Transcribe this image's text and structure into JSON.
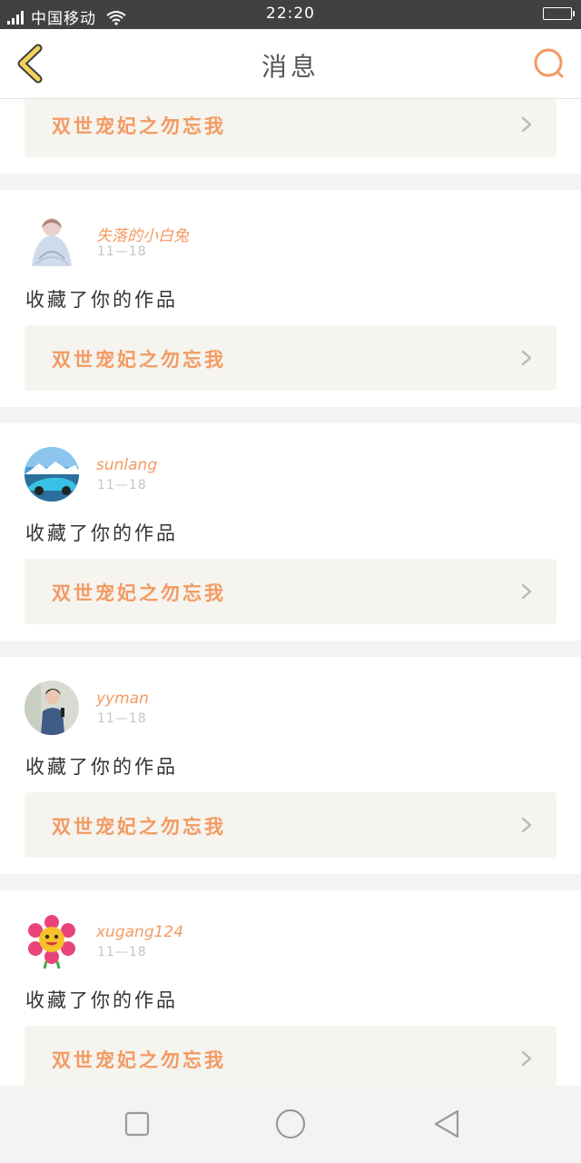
{
  "status_bar": {
    "carrier": "中国移动",
    "time": "22:20"
  },
  "header": {
    "title": "消息"
  },
  "top_partial": {
    "work_title": "双世宠妃之勿忘我"
  },
  "messages": [
    {
      "username": "失落的小白兔",
      "date": "11—18",
      "action": "收藏了你的作品",
      "work_title": "双世宠妃之勿忘我"
    },
    {
      "username": "sunlang",
      "date": "11—18",
      "action": "收藏了你的作品",
      "work_title": "双世宠妃之勿忘我"
    },
    {
      "username": "yyman",
      "date": "11—18",
      "action": "收藏了你的作品",
      "work_title": "双世宠妃之勿忘我"
    },
    {
      "username": "xugang124",
      "date": "11—18",
      "action": "收藏了你的作品",
      "work_title": "双世宠妃之勿忘我"
    }
  ],
  "colors": {
    "accent": "#f39a63",
    "back_icon": "#f2d25b",
    "status_bar": "#414141"
  }
}
